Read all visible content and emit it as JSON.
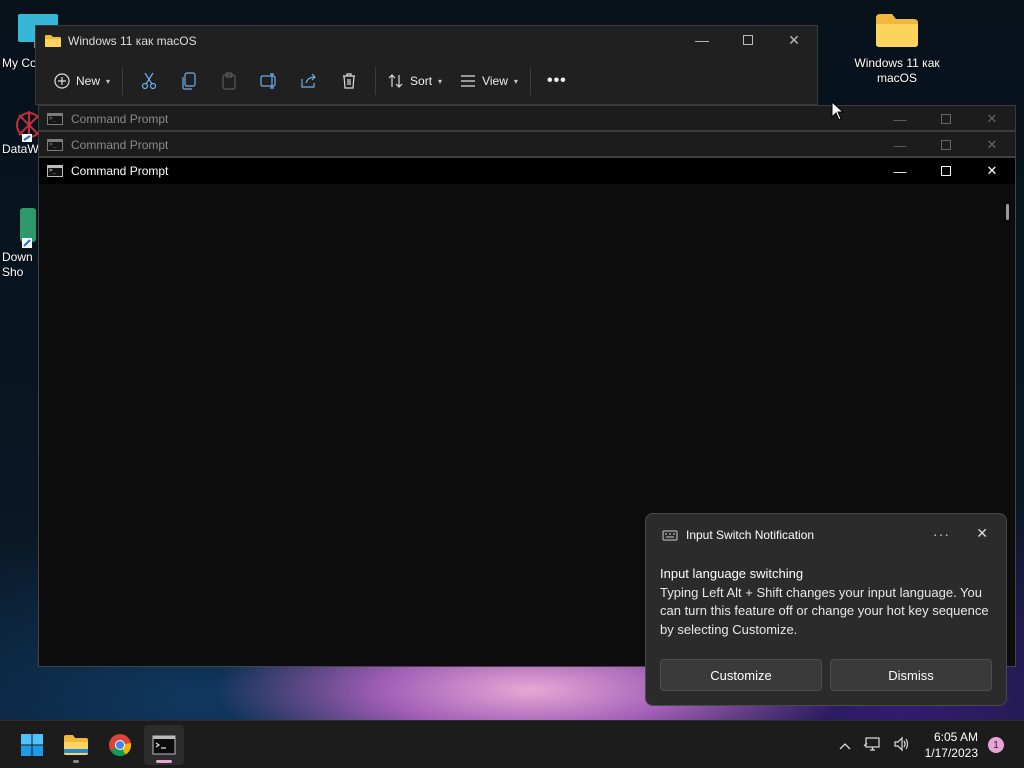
{
  "desktop": {
    "icons": [
      {
        "label": "My Co",
        "icon": "monitor-icon"
      },
      {
        "label": "DataW",
        "icon": "datawrapper-icon"
      },
      {
        "label": "Down Sho",
        "icon": "download-shortcut-icon"
      },
      {
        "label": "Windows 11 как macOS",
        "icon": "folder-icon"
      }
    ]
  },
  "explorer": {
    "title": "Windows 11 как macOS",
    "toolbar": {
      "new_label": "New",
      "sort_label": "Sort",
      "view_label": "View"
    }
  },
  "cmd_windows": [
    {
      "title": "Command Prompt",
      "state": "inactive"
    },
    {
      "title": "Command Prompt",
      "state": "inactive"
    },
    {
      "title": "Command Prompt",
      "state": "active"
    }
  ],
  "toast": {
    "app_name": "Input Switch Notification",
    "heading": "Input language switching",
    "message": "Typing Left Alt + Shift changes your input language. You can turn this feature off or change your hot key sequence by selecting Customize.",
    "customize_label": "Customize",
    "dismiss_label": "Dismiss"
  },
  "taskbar": {
    "time": "6:05 AM",
    "date": "1/17/2023",
    "notification_count": "1",
    "accent": "#e8a4d9"
  }
}
